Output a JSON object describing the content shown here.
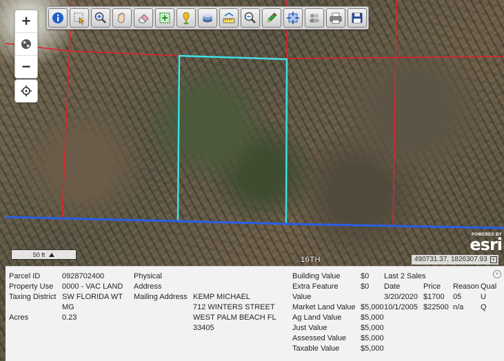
{
  "toolbar": {
    "tools": [
      "info-tool",
      "select-tool",
      "zoom-in-tool",
      "pan-tool",
      "eraser-tool",
      "measure-area-tool",
      "pin-tool",
      "layers-tool",
      "scale-tool",
      "zoom-out-tool",
      "draw-tool",
      "full-extent-tool",
      "print-tool",
      "printer-tool",
      "save-tool"
    ]
  },
  "zoom": {
    "in_label": "+",
    "out_label": "−"
  },
  "scale": {
    "label": "50 ft"
  },
  "map": {
    "street_label": "16TH",
    "coordinates": "490731.37, 1826307.93",
    "attribution_small": "POWERED BY",
    "attribution_logo": "esri"
  },
  "parcel": {
    "parcel_id_label": "Parcel ID",
    "parcel_id": "0928702400",
    "property_use_label": "Property Use",
    "property_use": "0000 - VAC LAND",
    "taxing_district_label": "Taxing District",
    "taxing_district_l1": "SW FLORIDA WT",
    "taxing_district_l2": "MG",
    "acres_label": "Acres",
    "acres": "0.23",
    "physical_address_label_l1": "Physical",
    "physical_address_label_l2": "Address",
    "mailing_address_label": "Mailing Address",
    "mailing_l1": "KEMP MICHAEL",
    "mailing_l2": "712 WINTERS STREET",
    "mailing_l3": "WEST PALM BEACH FL",
    "mailing_l4": "33405"
  },
  "values": {
    "building_value_label": "Building Value",
    "building_value": "$0",
    "extra_feature_label_l1": "Extra Feature",
    "extra_feature_label_l2": "Value",
    "extra_feature_value": "$0",
    "market_land_label": "Market Land Value",
    "market_land_value": "$5,000",
    "ag_land_label": "Ag Land Value",
    "ag_land_value": "$5,000",
    "just_value_label": "Just Value",
    "just_value": "$5,000",
    "assessed_value_label": "Assessed Value",
    "assessed_value": "$5,000",
    "taxable_value_label": "Taxable Value",
    "taxable_value": "$5,000"
  },
  "sales": {
    "title": "Last 2 Sales",
    "headers": [
      "Date",
      "Price",
      "Reason",
      "Qual"
    ],
    "rows": [
      [
        "3/20/2020",
        "$1700",
        "05",
        "U"
      ],
      [
        "10/1/2005",
        "$22500",
        "n/a",
        "Q"
      ]
    ]
  },
  "colors": {
    "parcel_line": "#e8202a",
    "selected_parcel": "#3ee0e8",
    "road_line": "#2a5ee8"
  }
}
